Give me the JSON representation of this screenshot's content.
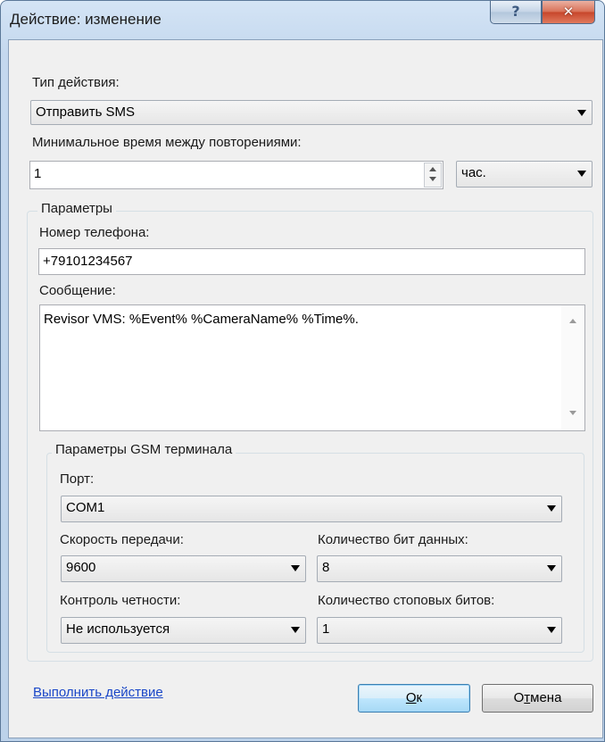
{
  "window": {
    "title": "Действие: изменение"
  },
  "titlebar_buttons": {
    "help": "?",
    "close": "✕"
  },
  "action_type": {
    "label": "Тип действия:",
    "value": "Отправить SMS"
  },
  "min_interval": {
    "label": "Минимальное время между повторениями:",
    "value": "1",
    "unit": "час."
  },
  "params": {
    "legend": "Параметры",
    "phone": {
      "label": "Номер телефона:",
      "value": "+79101234567"
    },
    "message": {
      "label": "Сообщение:",
      "value": "Revisor VMS: %Event% %CameraName% %Time%."
    }
  },
  "gsm": {
    "legend": "Параметры GSM терминала",
    "port": {
      "label": "Порт:",
      "value": "COM1"
    },
    "baud": {
      "label": "Скорость передачи:",
      "value": "9600"
    },
    "data_bits": {
      "label": "Количество бит данных:",
      "value": "8"
    },
    "parity": {
      "label": "Контроль четности:",
      "value": "Не используется"
    },
    "stop_bits": {
      "label": "Количество стоповых битов:",
      "value": "1"
    }
  },
  "footer": {
    "link": "Выполнить действие",
    "ok": {
      "prefix": "",
      "mnemonic": "О",
      "suffix": "к"
    },
    "cancel": {
      "prefix": "О",
      "mnemonic": "т",
      "suffix": "мена"
    }
  }
}
